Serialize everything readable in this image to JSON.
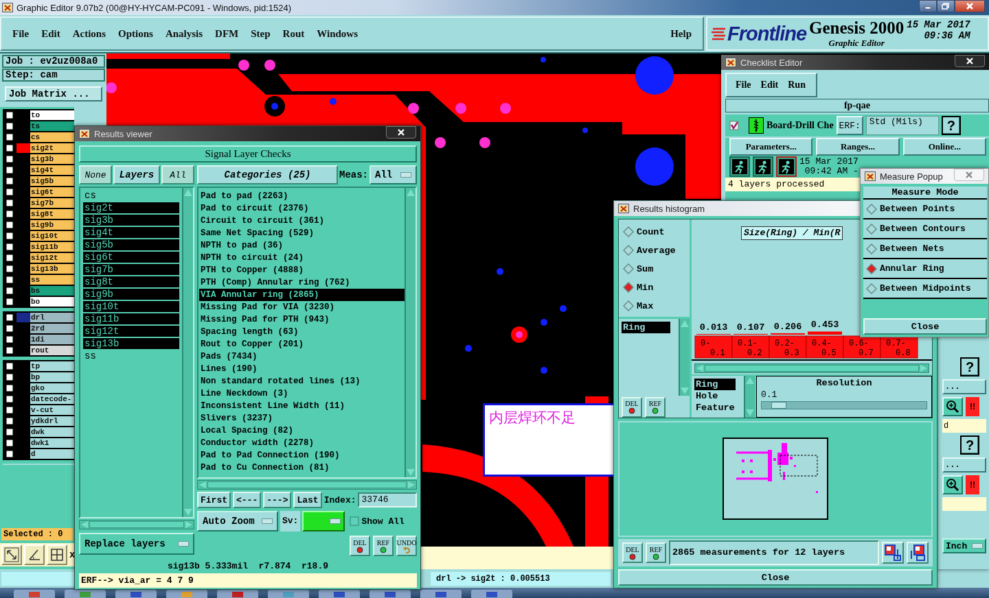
{
  "window": {
    "title": "Graphic Editor 9.07b2 (00@HY-HYCAM-PC091 - Windows, pid:1524)"
  },
  "menu": [
    "File",
    "Edit",
    "Actions",
    "Options",
    "Analysis",
    "DFM",
    "Step",
    "Rout",
    "Windows"
  ],
  "help": "Help",
  "branding": {
    "logo": "Frontline",
    "product": "Genesis 2000",
    "subtitle": "Graphic Editor",
    "date": "15 Mar 2017",
    "time": "09:36 AM"
  },
  "job_panel": {
    "job": "Job : ev2uz008a0",
    "step": "Step: cam",
    "matrix_button": "Job Matrix ...",
    "layer_groups": [
      {
        "layers": [
          {
            "name": "to",
            "kind": "silk",
            "checked": false
          },
          {
            "name": "ts",
            "kind": "mask",
            "checked": false
          },
          {
            "name": "cs",
            "kind": "signal",
            "checked": false
          },
          {
            "name": "sig2t",
            "kind": "signal",
            "checked": false,
            "color": "#ff0000"
          },
          {
            "name": "sig3b",
            "kind": "signal",
            "checked": false
          },
          {
            "name": "sig4t",
            "kind": "signal",
            "checked": false
          },
          {
            "name": "sig5b",
            "kind": "signal",
            "checked": false
          },
          {
            "name": "sig6t",
            "kind": "signal",
            "checked": false
          },
          {
            "name": "sig7b",
            "kind": "signal",
            "checked": false
          },
          {
            "name": "sig8t",
            "kind": "signal",
            "checked": false
          },
          {
            "name": "sig9b",
            "kind": "signal",
            "checked": false
          },
          {
            "name": "sig10t",
            "kind": "signal",
            "checked": false
          },
          {
            "name": "sig11b",
            "kind": "signal",
            "checked": false
          },
          {
            "name": "sig12t",
            "kind": "signal",
            "checked": false
          },
          {
            "name": "sig13b",
            "kind": "signal",
            "checked": false
          },
          {
            "name": "ss",
            "kind": "signal",
            "checked": false
          },
          {
            "name": "bs",
            "kind": "mask",
            "checked": false
          },
          {
            "name": "bo",
            "kind": "silk",
            "checked": false
          }
        ]
      },
      {
        "layers": [
          {
            "name": "drl",
            "kind": "drill",
            "checked": false,
            "color": "#1a2a8a"
          },
          {
            "name": "2rd",
            "kind": "drill",
            "checked": false
          },
          {
            "name": "1di",
            "kind": "drill",
            "checked": false
          },
          {
            "name": "rout",
            "kind": "rout",
            "checked": false
          }
        ]
      },
      {
        "layers": [
          {
            "name": "tp",
            "kind": "document",
            "checked": false
          },
          {
            "name": "bp",
            "kind": "document",
            "checked": false
          },
          {
            "name": "gko",
            "kind": "document",
            "checked": false
          },
          {
            "name": "datecode-",
            "kind": "document",
            "checked": false
          },
          {
            "name": "v-cut",
            "kind": "document",
            "checked": false
          },
          {
            "name": "ydkdrl",
            "kind": "document",
            "checked": false
          },
          {
            "name": "dwk",
            "kind": "document",
            "checked": false
          },
          {
            "name": "dwk1",
            "kind": "document",
            "checked": false
          },
          {
            "name": "d",
            "kind": "document",
            "checked": false
          }
        ]
      }
    ],
    "selected_count": "Selected : 0",
    "tool_label": "x"
  },
  "canvas": {
    "note": "内层焊环不足"
  },
  "status_bar": {
    "measurement": "drl -> sig2t : 0.005513"
  },
  "results_viewer": {
    "title": "Results viewer",
    "heading": "Signal Layer Checks",
    "layer_buttons": [
      "None",
      "Layers",
      "All"
    ],
    "layers": [
      {
        "name": "cs",
        "selected": false
      },
      {
        "name": "sig2t",
        "selected": true
      },
      {
        "name": "sig3b",
        "selected": true
      },
      {
        "name": "sig4t",
        "selected": true
      },
      {
        "name": "sig5b",
        "selected": true
      },
      {
        "name": "sig6t",
        "selected": true
      },
      {
        "name": "sig7b",
        "selected": true
      },
      {
        "name": "sig8t",
        "selected": true
      },
      {
        "name": "sig9b",
        "selected": true
      },
      {
        "name": "sig10t",
        "selected": true
      },
      {
        "name": "sig11b",
        "selected": true
      },
      {
        "name": "sig12t",
        "selected": true
      },
      {
        "name": "sig13b",
        "selected": true
      },
      {
        "name": "ss",
        "selected": false
      }
    ],
    "categories_header": "Categories (25)",
    "meas_label": "Meas:",
    "meas_value": "All",
    "categories": [
      {
        "label": "Pad to pad (2263)",
        "selected": false
      },
      {
        "label": "Pad to circuit (2376)",
        "selected": false
      },
      {
        "label": "Circuit to circuit (361)",
        "selected": false
      },
      {
        "label": "Same Net Spacing (529)",
        "selected": false
      },
      {
        "label": "NPTH to pad (36)",
        "selected": false
      },
      {
        "label": "NPTH to circuit (24)",
        "selected": false
      },
      {
        "label": "PTH to Copper (4888)",
        "selected": false
      },
      {
        "label": "PTH (Comp) Annular ring (762)",
        "selected": false
      },
      {
        "label": "VIA Annular ring (2865)",
        "selected": true
      },
      {
        "label": "Missing Pad for VIA (3230)",
        "selected": false
      },
      {
        "label": "Missing Pad for PTH (943)",
        "selected": false
      },
      {
        "label": "Spacing length (63)",
        "selected": false
      },
      {
        "label": "Rout to Copper (201)",
        "selected": false
      },
      {
        "label": "Pads (7434)",
        "selected": false
      },
      {
        "label": "Lines (190)",
        "selected": false
      },
      {
        "label": "Non standard rotated lines (13)",
        "selected": false
      },
      {
        "label": "Line Neckdown (3)",
        "selected": false
      },
      {
        "label": "Inconsistent Line Width (11)",
        "selected": false
      },
      {
        "label": "Slivers (3237)",
        "selected": false
      },
      {
        "label": "Local Spacing (82)",
        "selected": false
      },
      {
        "label": "Conductor width (2278)",
        "selected": false
      },
      {
        "label": "Pad to Pad Connection (190)",
        "selected": false
      },
      {
        "label": "Pad to Cu Connection (81)",
        "selected": false
      }
    ],
    "nav_buttons": [
      "First",
      "<---",
      "--->",
      "Last"
    ],
    "index_label": "Index:",
    "index_value": "33746",
    "zoom_mode": "Auto Zoom",
    "sv_label": "Sv:",
    "show_all": {
      "label": "Show All",
      "checked": false
    },
    "replace_mode": "Replace layers",
    "tool_buttons": [
      {
        "label": "DEL",
        "kind": "del"
      },
      {
        "label": "REF",
        "kind": "ref"
      },
      {
        "label": "UNDO",
        "kind": "undo"
      }
    ],
    "status": "sig13b 5.333mil  r7.874  r18.9",
    "erf": "ERF--> via_ar = 4 7 9"
  },
  "checklist_editor": {
    "title": "Checklist Editor",
    "menu": [
      "File",
      "Edit",
      "Run"
    ],
    "checklist": "fp-qae",
    "action": {
      "checked": true,
      "name": "Board-Drill Che",
      "erf_button": "ERF:",
      "erf_value": "Std (Mils)",
      "help": "?"
    },
    "buttons": [
      "Parameters...",
      "Ranges...",
      "Online..."
    ],
    "run_date": "15 Mar 2017",
    "run_time": "09:42 AM -",
    "message": "4 layers processed",
    "side_controls": [
      {
        "kind": "help",
        "label": "?"
      },
      {
        "kind": "more",
        "label": "..."
      },
      {
        "kind": "zoom",
        "label": "!!"
      },
      {
        "kind": "field",
        "label": "d"
      },
      {
        "kind": "help",
        "label": "?"
      },
      {
        "kind": "more",
        "label": "..."
      },
      {
        "kind": "zoom",
        "label": "!!"
      },
      {
        "kind": "field"
      },
      {
        "kind": "units",
        "label": "Inch"
      }
    ]
  },
  "results_histogram": {
    "title": "Results histogram",
    "functions": [
      {
        "label": "Count",
        "selected": false
      },
      {
        "label": "Average",
        "selected": false
      },
      {
        "label": "Sum",
        "selected": false
      },
      {
        "label": "Min",
        "selected": true
      },
      {
        "label": "Max",
        "selected": false
      }
    ],
    "fields": [
      {
        "label": "Ring",
        "selected": true
      }
    ],
    "field_buttons": [
      {
        "label": "DEL",
        "kind": "del"
      },
      {
        "label": "REF",
        "kind": "ref"
      }
    ],
    "chart_title": "Size(Ring) / Min(R",
    "chart_data": {
      "type": "bar",
      "categories": [
        "0-0.1",
        "0.1-0.2",
        "0.2-0.3",
        "0.4-0.5",
        "0.6-0.7",
        "0.7-0.8"
      ],
      "values": [
        0.013,
        0.107,
        0.206,
        0.453,
        null,
        null
      ],
      "data_labels": true
    },
    "attributes": [
      {
        "label": "Ring",
        "selected": true
      },
      {
        "label": "Hole",
        "selected": false
      },
      {
        "label": "Feature",
        "selected": false
      }
    ],
    "resolution_label": "Resolution",
    "resolution": "0.1",
    "resolution_slider": {
      "level": 0.06
    },
    "summary_buttons": [
      {
        "label": "DEL",
        "kind": "del"
      },
      {
        "label": "REF",
        "kind": "ref"
      }
    ],
    "summary": "2865 measurements for 12 layers",
    "close": "Close"
  },
  "measure_popup": {
    "title": "Measure Popup",
    "heading": "Measure Mode",
    "modes": [
      {
        "label": "Between Points",
        "selected": false
      },
      {
        "label": "Between Contours",
        "selected": false
      },
      {
        "label": "Between Nets",
        "selected": false
      },
      {
        "label": "Annular Ring",
        "selected": true
      },
      {
        "label": "Between Midpoints",
        "selected": false
      }
    ],
    "close": "Close"
  }
}
